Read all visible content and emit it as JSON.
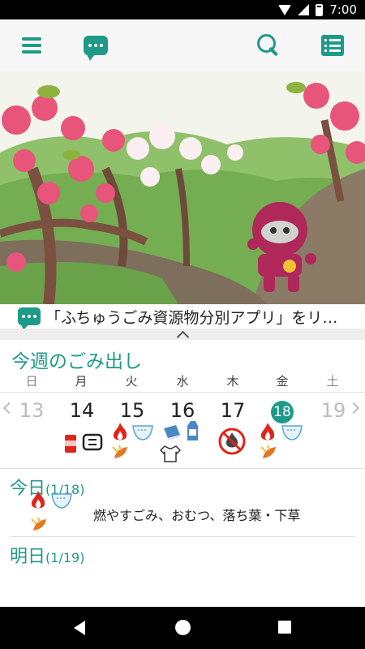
{
  "status_bar": {
    "time": "7:00"
  },
  "app_bar": {
    "icons": [
      "menu-icon",
      "chat-icon",
      "search-icon",
      "list-icon"
    ],
    "accent": "#1e9a88"
  },
  "ticker": {
    "text": "「ふちゅうごみ資源物分別アプリ」をリ…"
  },
  "week": {
    "title": "今週のごみ出し",
    "days_of_week": [
      "日",
      "月",
      "火",
      "水",
      "木",
      "金",
      "土"
    ],
    "dates": [
      "13",
      "14",
      "15",
      "16",
      "17",
      "18",
      "19"
    ],
    "today_date": "18",
    "icons_by_day": {
      "14": [
        "can-bottle-icon",
        "recycle-pet-icon"
      ],
      "15": [
        "fire-icon",
        "diaper-icon",
        "leaf-icon",
        "clothes-icon"
      ],
      "16": [
        "book-icon",
        "milk-carton-icon"
      ],
      "17": [
        "no-fire-icon"
      ],
      "18": [
        "fire-icon",
        "diaper-icon",
        "leaf-icon"
      ]
    }
  },
  "today": {
    "label": "今日",
    "date": "(1/18)",
    "items": "燃やすごみ、おむつ、落ち葉・下草"
  },
  "tomorrow": {
    "label": "明日",
    "date": "(1/19)"
  },
  "colors": {
    "accent": "#1e9a88",
    "fire": "#e2231a",
    "leaf": "#e07a27"
  }
}
